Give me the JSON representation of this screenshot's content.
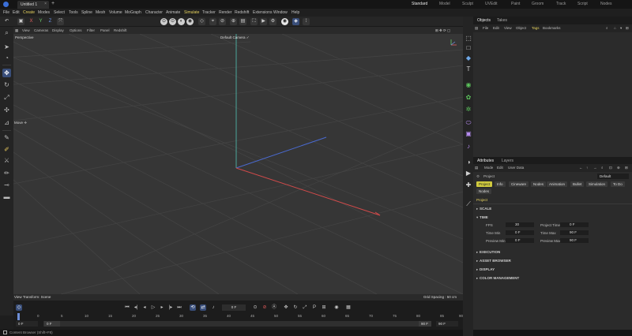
{
  "app": {
    "doc_tab": "Untitled 1",
    "layouts": [
      "Standard",
      "Model",
      "Sculpt",
      "UVEdit",
      "Paint",
      "Groom",
      "Track",
      "Script",
      "Nodes"
    ],
    "active_layout": "Standard"
  },
  "menu": [
    "File",
    "Edit",
    "Create",
    "Modes",
    "Select",
    "Tools",
    "Spline",
    "Mesh",
    "Volume",
    "MoGraph",
    "Character",
    "Animate",
    "Simulate",
    "Tracker",
    "Render",
    "Redshift",
    "Extensions",
    "Window",
    "Help"
  ],
  "viewport": {
    "menu": [
      "View",
      "Cameras",
      "Display",
      "Options",
      "Filter",
      "Panel",
      "Redshift"
    ],
    "label": "Perspective",
    "camera": "Default Camera ✓",
    "tool_tip": "Move ✛",
    "transform": "View Transform: Scene",
    "grid": "Grid Spacing : 50 cm",
    "colors": {
      "x_axis": "#d04a4a",
      "y_axis": "#4fb3a5",
      "z_axis": "#4a6ad0",
      "grid": "#444444",
      "bg": "#363636"
    }
  },
  "timeline": {
    "current_frame": "0 F",
    "ticks": [
      "0",
      "5",
      "10",
      "15",
      "20",
      "25",
      "30",
      "35",
      "40",
      "45",
      "50",
      "55",
      "60",
      "65",
      "70",
      "75",
      "80",
      "85",
      "90"
    ],
    "range_start": "0 F",
    "range_start2": "0 F",
    "range_end": "90 F",
    "range_end2": "90 F"
  },
  "status_bar": "Content Browser (Shift+F8)",
  "objects_panel": {
    "tabs": [
      "Objects",
      "Takes"
    ],
    "menu": [
      "File",
      "Edit",
      "View",
      "Object",
      "Tags",
      "Bookmarks"
    ]
  },
  "attributes_panel": {
    "tabs": [
      "Attributes",
      "Layers"
    ],
    "menu": [
      "Mode",
      "Edit",
      "User Data"
    ],
    "object_name": "Project",
    "dropdown": "Default",
    "chips": [
      "Project",
      "Info",
      "Cineware",
      "Nodes",
      "Animation",
      "Bullet",
      "Simulation",
      "To Do"
    ],
    "chips_row2": [
      "Nodes"
    ],
    "heading": "Project",
    "sections": [
      "SCALE",
      "TIME",
      "EXECUTION",
      "ASSET BROWSER",
      "DISPLAY",
      "COLOR MANAGEMENT"
    ],
    "time": {
      "fps_label": "FPS",
      "fps": "30",
      "project_time_label": "Project Time",
      "project_time": "0 F",
      "min_label": "Time Min",
      "min": "0 F",
      "max_label": "Time Max",
      "max": "90 F",
      "pmin_label": "Preview Min",
      "pmin": "0 F",
      "pmax_label": "Preview Max",
      "pmax": "90 F"
    }
  }
}
